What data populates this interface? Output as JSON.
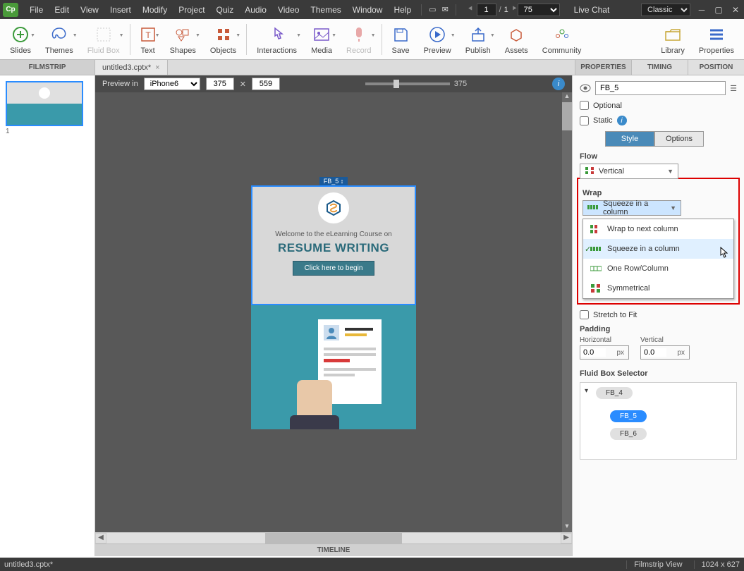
{
  "menubar": {
    "logo": "Cp",
    "items": [
      "File",
      "Edit",
      "View",
      "Insert",
      "Modify",
      "Project",
      "Quiz",
      "Audio",
      "Video",
      "Themes",
      "Window",
      "Help"
    ],
    "page_current": "1",
    "page_total": "1",
    "zoom": "75",
    "live_chat": "Live Chat",
    "workspace": "Classic"
  },
  "ribbon": {
    "tools": [
      {
        "label": "Slides",
        "icon": "plus-circle"
      },
      {
        "label": "Themes",
        "icon": "palette"
      },
      {
        "label": "Fluid Box",
        "icon": "grid-dash",
        "disabled": true
      },
      {
        "sep": true
      },
      {
        "label": "Text",
        "icon": "text"
      },
      {
        "label": "Shapes",
        "icon": "shapes"
      },
      {
        "label": "Objects",
        "icon": "objects"
      },
      {
        "sep": true
      },
      {
        "label": "Interactions",
        "icon": "cursor"
      },
      {
        "label": "Media",
        "icon": "image"
      },
      {
        "label": "Record",
        "icon": "mic",
        "disabled": true
      },
      {
        "sep": true
      },
      {
        "label": "Save",
        "icon": "save"
      },
      {
        "label": "Preview",
        "icon": "play"
      },
      {
        "label": "Publish",
        "icon": "upload"
      },
      {
        "label": "Assets",
        "icon": "box"
      },
      {
        "label": "Community",
        "icon": "people"
      },
      {
        "spacer": true
      },
      {
        "label": "Library",
        "icon": "folder"
      },
      {
        "label": "Properties",
        "icon": "menu"
      }
    ]
  },
  "tabbar": {
    "filmstrip": "FILMSTRIP",
    "file_tab": "untitled3.cptx*",
    "prop_tabs": [
      "PROPERTIES",
      "TIMING",
      "POSITION"
    ],
    "active_prop_tab": 0
  },
  "filmstrip": {
    "slides": [
      {
        "num": "1"
      }
    ]
  },
  "preview_bar": {
    "label": "Preview in",
    "device": "iPhone6",
    "w": "375",
    "h": "559",
    "ruler_val": "375"
  },
  "stage": {
    "fb_label": "FB_5 ↕",
    "welcome": "Welcome to the eLearning Course on",
    "title": "RESUME WRITING",
    "begin_btn": "Click here to begin"
  },
  "timeline": "TIMELINE",
  "props": {
    "name_value": "FB_5",
    "optional": "Optional",
    "static": "Static",
    "tabs": {
      "style": "Style",
      "options": "Options"
    },
    "flow_label": "Flow",
    "flow_value": "Vertical",
    "wrap_label": "Wrap",
    "wrap_value": "Squeeze in a column",
    "wrap_options": [
      {
        "label": "Wrap to next column",
        "icon": "wrap-next"
      },
      {
        "label": "Squeeze in a column",
        "icon": "squeeze",
        "selected": true
      },
      {
        "label": "One Row/Column",
        "icon": "one-row"
      },
      {
        "label": "Symmetrical",
        "icon": "symm"
      }
    ],
    "stretch": "Stretch to Fit",
    "padding_label": "Padding",
    "padding_h_label": "Horizontal",
    "padding_v_label": "Vertical",
    "padding_h": "0.0",
    "padding_v": "0.0",
    "padding_unit": "px",
    "fbs_label": "Fluid Box Selector",
    "fbs_tree": {
      "root": "FB_4",
      "children": [
        "FB_5",
        "FB_6"
      ],
      "active": "FB_5"
    }
  },
  "statusbar": {
    "file": "untitled3.cptx*",
    "view": "Filmstrip View",
    "dim": "1024 x 627"
  }
}
